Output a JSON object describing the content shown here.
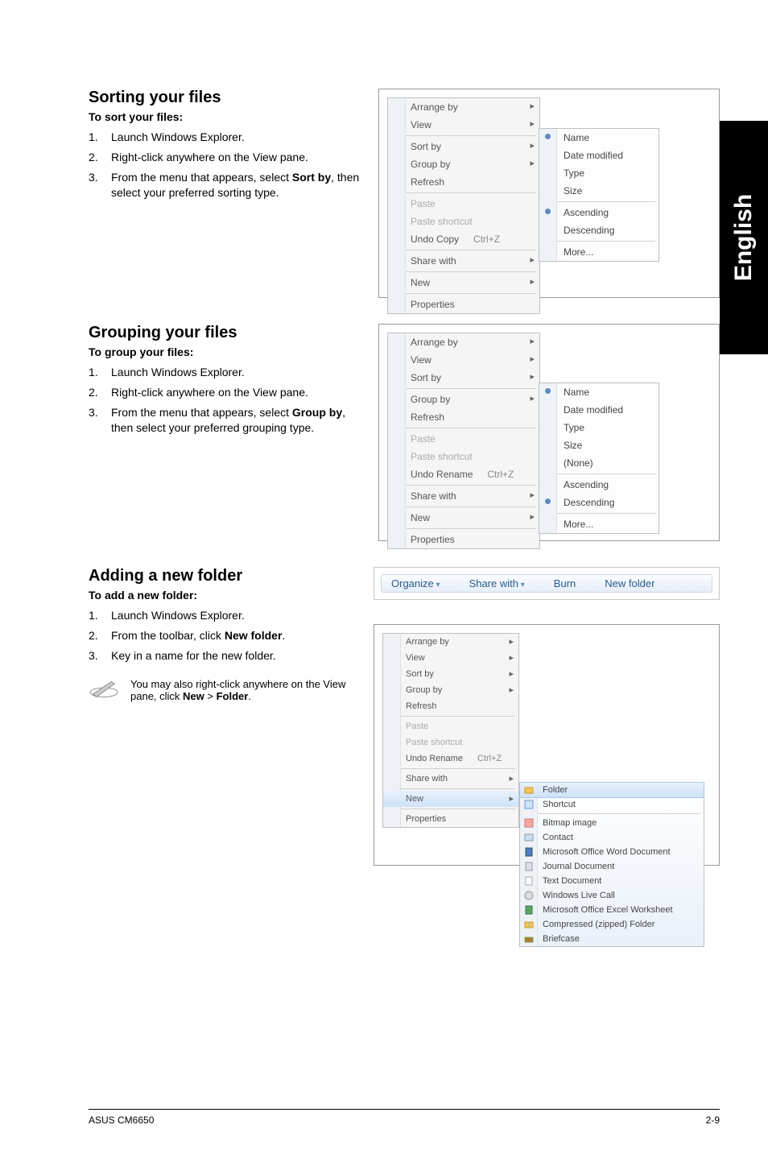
{
  "side_tab": "English",
  "section1": {
    "heading": "Sorting your files",
    "subhead": "To sort your files:",
    "steps": [
      "Launch Windows Explorer.",
      "Right-click anywhere on the View pane.",
      "From the menu that appears, select Sort by, then select your preferred sorting type."
    ]
  },
  "section2": {
    "heading": "Grouping your files",
    "subhead": "To group your files:",
    "steps": [
      "Launch Windows Explorer.",
      "Right-click anywhere on the View pane.",
      "From the menu that appears, select Group by, then select your preferred grouping type."
    ]
  },
  "section3": {
    "heading": "Adding a new folder",
    "subhead": "To add a new folder:",
    "steps": [
      "Launch Windows Explorer.",
      "From the toolbar, click New folder.",
      "Key in a name for the new folder."
    ],
    "note": "You may also right-click anywhere on the View pane, click New > Folder."
  },
  "menu_sort": {
    "items_top": [
      "Arrange by",
      "View"
    ],
    "items_mid": [
      "Sort by",
      "Group by",
      "Refresh"
    ],
    "items_paste": [
      "Paste",
      "Paste shortcut"
    ],
    "undo": {
      "label": "Undo Copy",
      "kbd": "Ctrl+Z"
    },
    "share": "Share with",
    "new": "New",
    "properties": "Properties",
    "sort_sub": [
      "Name",
      "Date modified",
      "Type",
      "Size"
    ],
    "sort_sub2": [
      "Ascending",
      "Descending"
    ],
    "more": "More..."
  },
  "menu_group": {
    "items_top": [
      "Arrange by",
      "View",
      "Sort by"
    ],
    "group": "Group by",
    "refresh": "Refresh",
    "items_paste": [
      "Paste",
      "Paste shortcut"
    ],
    "undo": {
      "label": "Undo Rename",
      "kbd": "Ctrl+Z"
    },
    "share": "Share with",
    "new": "New",
    "properties": "Properties",
    "group_sub": [
      "Name",
      "Date modified",
      "Type",
      "Size",
      "(None)"
    ],
    "group_sub2": [
      "Ascending",
      "Descending"
    ],
    "more": "More..."
  },
  "toolbar": {
    "organize": "Organize",
    "share": "Share with",
    "burn": "Burn",
    "newfolder": "New folder"
  },
  "menu_new": {
    "items_top": [
      "Arrange by",
      "View",
      "Sort by",
      "Group by",
      "Refresh"
    ],
    "items_paste": [
      "Paste",
      "Paste shortcut"
    ],
    "undo": {
      "label": "Undo Rename",
      "kbd": "Ctrl+Z"
    },
    "share": "Share with",
    "new": "New",
    "properties": "Properties",
    "new_sub_top": [
      "Folder",
      "Shortcut"
    ],
    "new_sub_rest": [
      "Bitmap image",
      "Contact",
      "Microsoft Office Word Document",
      "Journal Document",
      "Text Document",
      "Windows Live Call",
      "Microsoft Office Excel Worksheet",
      "Compressed (zipped) Folder",
      "Briefcase"
    ]
  },
  "footer": {
    "left": "ASUS CM6650",
    "right": "2-9"
  }
}
